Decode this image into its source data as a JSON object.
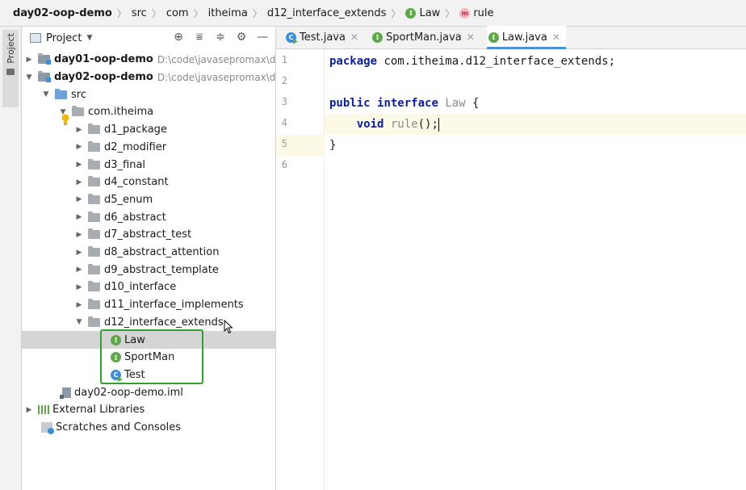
{
  "breadcrumb": {
    "items": [
      "day02-oop-demo",
      "src",
      "com",
      "itheima",
      "d12_interface_extends",
      "Law",
      "rule"
    ],
    "icons": {
      "interface": "I",
      "method": "m"
    }
  },
  "sidebar_strip": {
    "tab_label": "Project"
  },
  "project_panel": {
    "title": "Project",
    "tools": [
      "target-icon",
      "expand-all-icon",
      "collapse-all-icon",
      "gear-icon",
      "minimize-icon"
    ],
    "tree": [
      {
        "label": "day01-oop-demo",
        "path": "D:\\code\\javasepromax\\d",
        "bold": true
      },
      {
        "label": "day02-oop-demo",
        "path": "D:\\code\\javasepromax\\d",
        "bold": true
      },
      {
        "label": "src"
      },
      {
        "label": "com.itheima"
      },
      {
        "label": "d1_package"
      },
      {
        "label": "d2_modifier"
      },
      {
        "label": "d3_final"
      },
      {
        "label": "d4_constant"
      },
      {
        "label": "d5_enum"
      },
      {
        "label": "d6_abstract"
      },
      {
        "label": "d7_abstract_test"
      },
      {
        "label": "d8_abstract_attention"
      },
      {
        "label": "d9_abstract_template"
      },
      {
        "label": "d10_interface"
      },
      {
        "label": "d11_interface_implements"
      },
      {
        "label": "d12_interface_extends"
      },
      {
        "label": "Law",
        "icon": "I"
      },
      {
        "label": "SportMan",
        "icon": "I"
      },
      {
        "label": "Test",
        "icon": "C"
      },
      {
        "label": "day02-oop-demo.iml"
      },
      {
        "label": "External Libraries"
      },
      {
        "label": "Scratches and Consoles"
      }
    ]
  },
  "editor": {
    "tabs": [
      {
        "label": "Test.java",
        "icon": "C"
      },
      {
        "label": "SportMan.java",
        "icon": "I"
      },
      {
        "label": "Law.java",
        "icon": "I"
      }
    ],
    "line_numbers": [
      "1",
      "2",
      "3",
      "4",
      "5",
      "6"
    ],
    "code": {
      "l1_kw": "package",
      "l1_rest": " com.itheima.d12_interface_extends;",
      "l3_kw1": "public",
      "l3_kw2": "interface",
      "l3_type": "Law",
      "l3_rest": " {",
      "l4_kw": "void",
      "l4_method": "rule",
      "l4_rest": "();",
      "l5": "}"
    }
  },
  "colors": {
    "selection_highlight": "#2ea12e",
    "keyword": "#0a1f9a",
    "active_tab_underline": "#4a8fe0",
    "interface_icon": "#5fa84a",
    "class_icon": "#3e8ed8"
  }
}
